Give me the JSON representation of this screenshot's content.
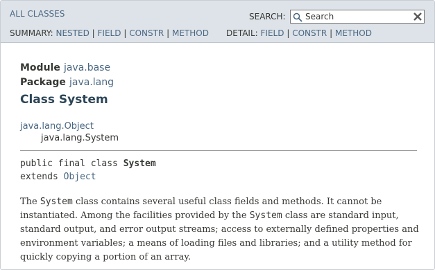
{
  "nav": {
    "all_classes": "ALL CLASSES",
    "search_label": "SEARCH:",
    "search_placeholder": "Search",
    "summary_label": "SUMMARY:",
    "summary_links": [
      "NESTED",
      "FIELD",
      "CONSTR",
      "METHOD"
    ],
    "detail_label": "DETAIL:",
    "detail_links": [
      "FIELD",
      "CONSTR",
      "METHOD"
    ],
    "separator": "|"
  },
  "header": {
    "module_label": "Module",
    "module_name": "java.base",
    "package_label": "Package",
    "package_name": "java.lang",
    "class_title": "Class System"
  },
  "inheritance": {
    "parent": "java.lang.Object",
    "child": "java.lang.System"
  },
  "signature": {
    "modifiers": "public final class",
    "name": "System",
    "extends_keyword": "extends",
    "superclass": "Object"
  },
  "description": {
    "p1": "The ",
    "code1": "System",
    "p2": " class contains several useful class fields and methods. It cannot be instantiated. Among the facilities provided by the ",
    "code2": "System",
    "p3": " class are standard input, standard output, and error output streams; access to externally defined properties and environment variables; a means of loading files and libraries; and a utility method for quickly copying a portion of an array."
  },
  "colors": {
    "topbar_bg": "#dee3e9",
    "link": "#4a6782",
    "text": "#353833",
    "title": "#2c4557"
  },
  "icons": {
    "search": "magnifier-icon",
    "reset": "close-x-icon"
  }
}
